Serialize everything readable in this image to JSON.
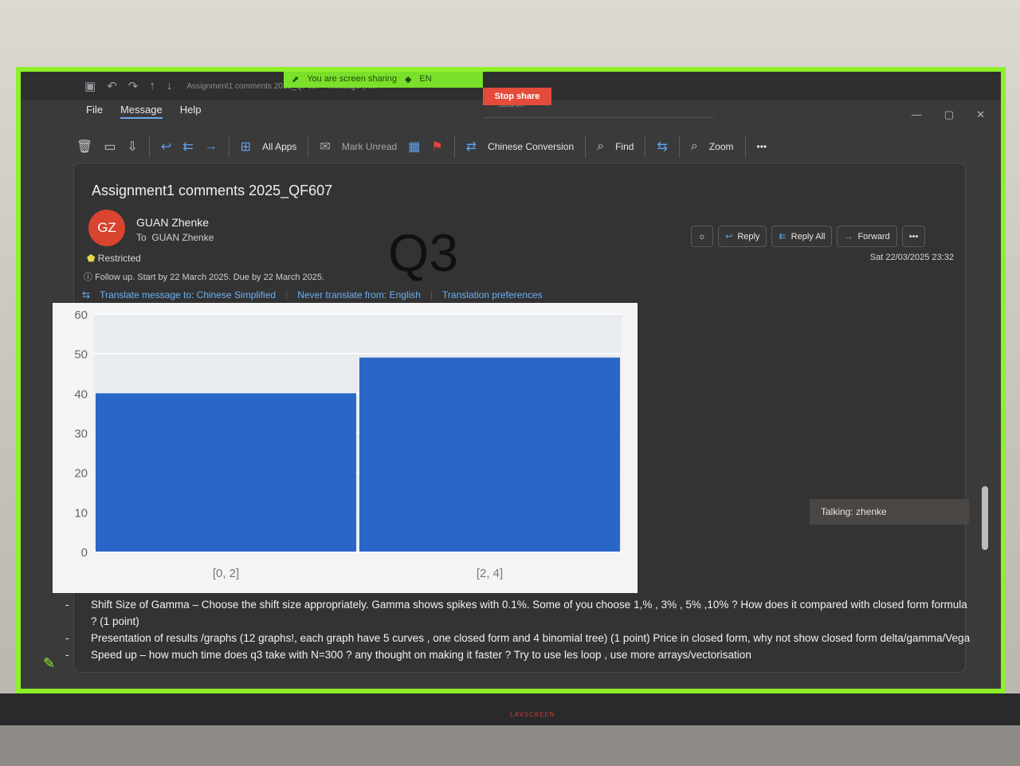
{
  "share": {
    "sharing_label": "You are screen sharing",
    "language": "EN",
    "stop_label": "Stop share"
  },
  "window": {
    "title": "Assignment1 comments 2025_QF607 - Message (H...",
    "search_placeholder": "Search"
  },
  "menu": {
    "tabs": [
      "File",
      "Message",
      "Help"
    ]
  },
  "ribbon": {
    "all_apps": "All Apps",
    "mark_unread": "Mark Unread",
    "chinese_conversion": "Chinese Conversion",
    "find": "Find",
    "zoom": "Zoom"
  },
  "message": {
    "subject": "Assignment1 comments 2025_QF607",
    "avatar_initials": "GZ",
    "sender": "GUAN Zhenke",
    "to_label": "To",
    "to_name": "GUAN Zhenke",
    "restricted": "Restricted",
    "followup": "Follow up.  Start by 22 March 2025.  Due by 22 March 2025.",
    "translate_to": "Translate message to: Chinese Simplified",
    "never_translate": "Never translate from: English",
    "translation_prefs": "Translation preferences",
    "overlay_text": "Q3",
    "reply": "Reply",
    "reply_all": "Reply All",
    "forward": "Forward",
    "timestamp": "Sat 22/03/2025 23:32",
    "talking": "Talking: zhenke"
  },
  "bullets": [
    "Shift Size of Gamma – Choose the shift size appropriately. Gamma shows spikes with 0.1%. Some of you choose 1,% , 3% , 5% ,10% ?  How does it compared with closed form formula ? (1 point)",
    "Presentation of results /graphs (12 graphs!, each graph have 5 curves , one closed form and 4 binomial tree) (1 point) Price in closed form, why not show closed form delta/gamma/Vega",
    "Speed up – how much time does q3 take with N=300 ?  any thought on making it faster ?  Try  to use les loop ,  use more arrays/vectorisation"
  ],
  "chart_data": {
    "type": "bar",
    "categories": [
      "[0, 2]",
      "[2, 4]"
    ],
    "values": [
      40,
      49
    ],
    "yticks": [
      "0",
      "10",
      "20",
      "30",
      "40",
      "50",
      "60"
    ],
    "ylim": [
      0,
      60
    ],
    "bar_color": "#2a66c8",
    "grid": true
  }
}
